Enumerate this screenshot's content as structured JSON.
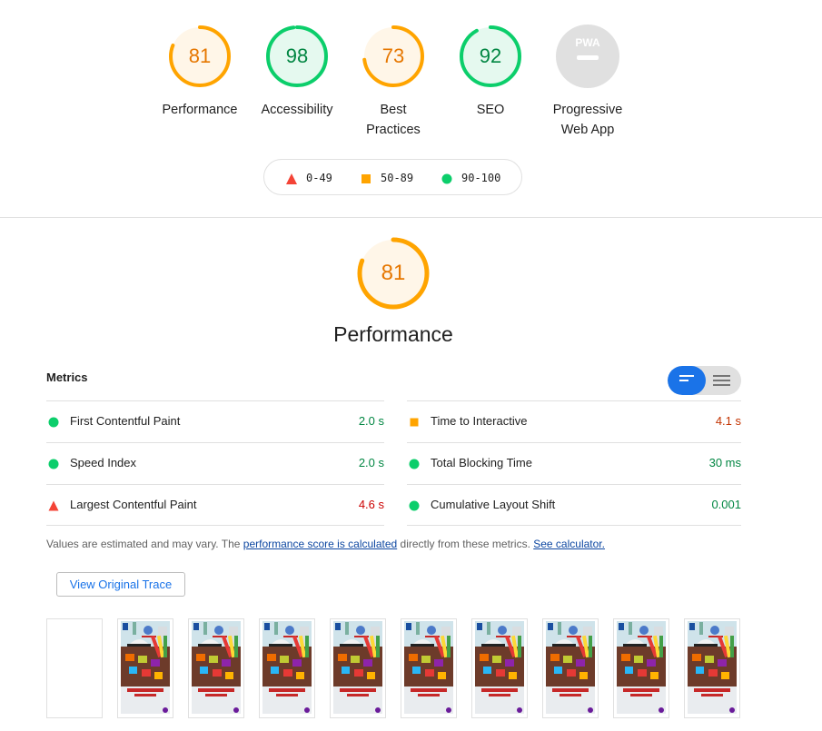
{
  "categories": [
    {
      "score": "81",
      "label": "Performance",
      "status": "average",
      "fraction": 0.81
    },
    {
      "score": "98",
      "label": "Accessibility",
      "status": "pass",
      "fraction": 0.98
    },
    {
      "score": "73",
      "label": "Best Practices",
      "status": "average",
      "fraction": 0.73
    },
    {
      "score": "92",
      "label": "SEO",
      "status": "pass",
      "fraction": 0.92
    },
    {
      "score": "",
      "label": "Progressive Web App",
      "status": "na",
      "badge": "PWA"
    }
  ],
  "legend": [
    {
      "range": "0-49",
      "shape": "triangle",
      "color": "#f44336"
    },
    {
      "range": "50-89",
      "shape": "square",
      "color": "#ffa400"
    },
    {
      "range": "90-100",
      "shape": "circle",
      "color": "#0cce6b"
    }
  ],
  "performance": {
    "score": "81",
    "title": "Performance",
    "fraction": 0.81
  },
  "metrics": {
    "title": "Metrics",
    "left": [
      {
        "name": "First Contentful Paint",
        "value": "2.0 s",
        "status": "pass"
      },
      {
        "name": "Speed Index",
        "value": "2.0 s",
        "status": "pass"
      },
      {
        "name": "Largest Contentful Paint",
        "value": "4.6 s",
        "status": "fail"
      }
    ],
    "right": [
      {
        "name": "Time to Interactive",
        "value": "4.1 s",
        "status": "average"
      },
      {
        "name": "Total Blocking Time",
        "value": "30 ms",
        "status": "pass"
      },
      {
        "name": "Cumulative Layout Shift",
        "value": "0.001",
        "status": "pass"
      }
    ]
  },
  "note": {
    "prefix": "Values are estimated and may vary. The ",
    "link1": "performance score is calculated",
    "middle": " directly from these metrics. ",
    "link2": "See calculator."
  },
  "trace_button": "View Original Trace",
  "colors": {
    "pass": "#0cce6b",
    "average": "#ffa400",
    "fail": "#f44336",
    "pass_text": "#018642",
    "average_text": "#c33300",
    "fail_text": "#cc0000",
    "accent": "#1a73e8"
  },
  "filmstrip": {
    "frames": 10,
    "blank_frames": 1
  }
}
